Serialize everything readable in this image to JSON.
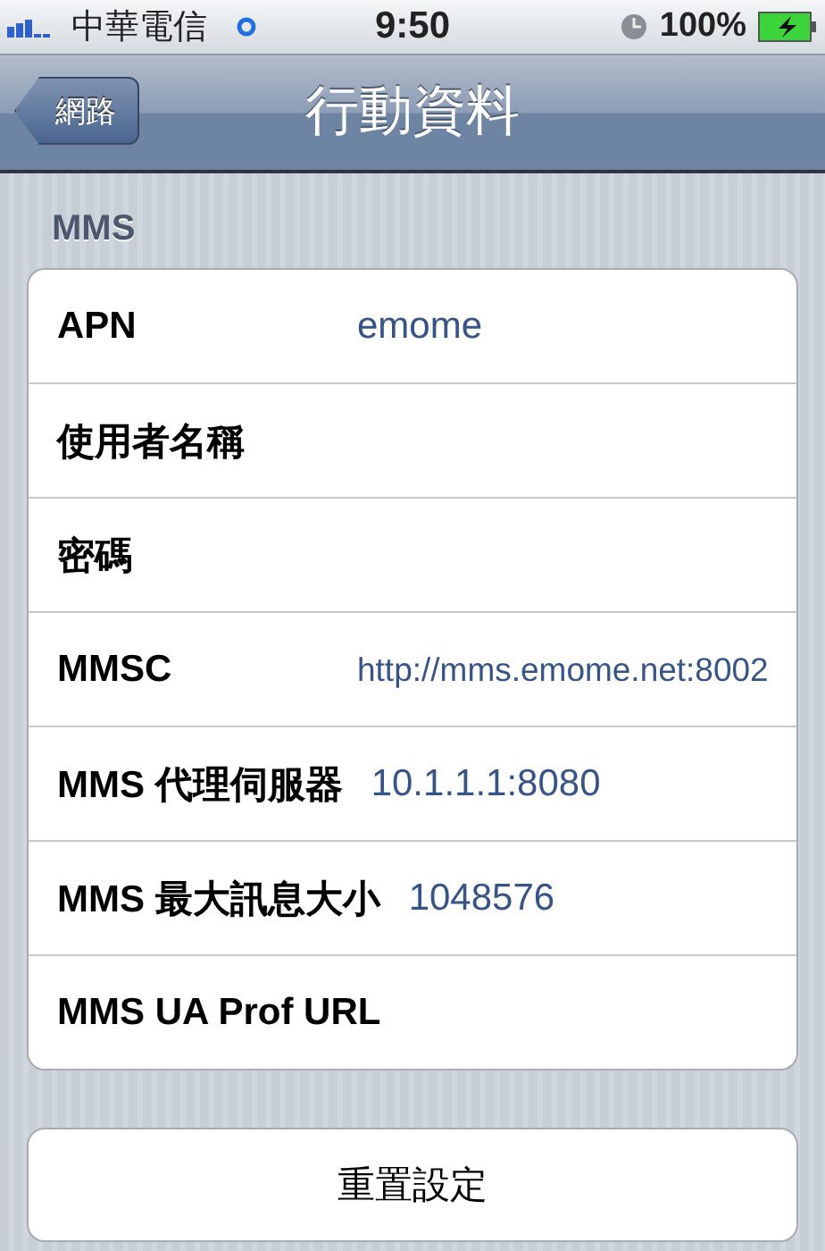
{
  "status_bar": {
    "carrier": "中華電信",
    "time": "9:50",
    "battery": "100%"
  },
  "nav_bar": {
    "back": "網路",
    "title": "行動資料"
  },
  "section": {
    "header": "MMS",
    "rows": [
      {
        "label": "APN",
        "value": "emome",
        "kind": "normal"
      },
      {
        "label": "使用者名稱"
      },
      {
        "label": "密碼"
      },
      {
        "label": "MMSC",
        "value": "http://mms.emome.net:8002",
        "kind": "small"
      },
      {
        "label": "MMS 代理伺服器",
        "value": "10.1.1.1:8080",
        "kind": "normal"
      },
      {
        "label": "MMS 最大訊息大小",
        "value": "1048576",
        "kind": "normal"
      },
      {
        "label": "MMS UA Prof URL"
      }
    ]
  },
  "reset_button": "重置設定"
}
